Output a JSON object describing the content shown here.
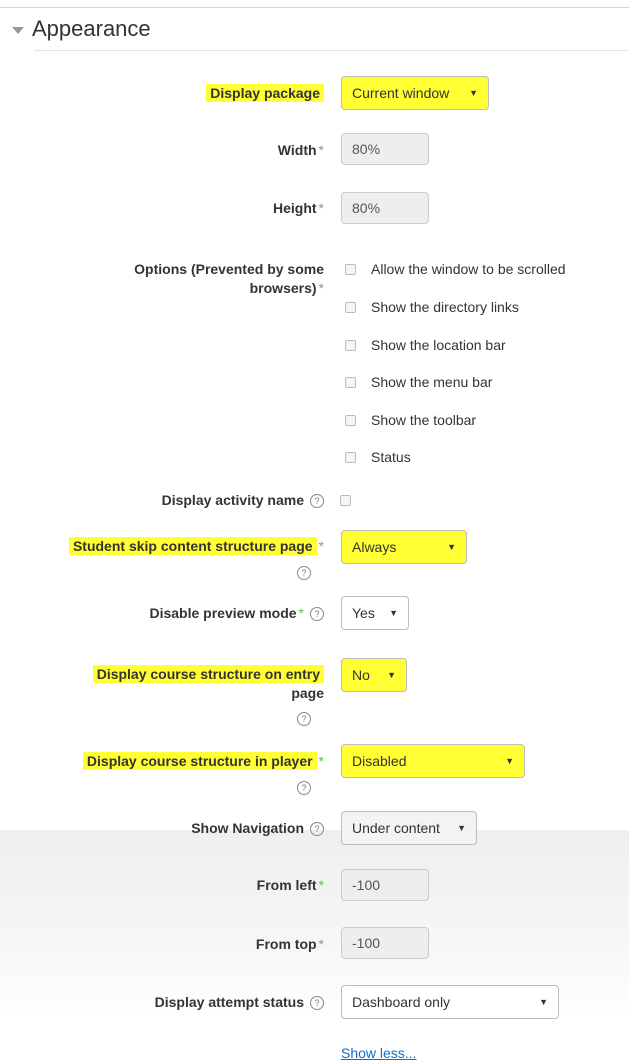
{
  "section": {
    "title": "Appearance"
  },
  "fields": {
    "display_package": {
      "label": "Display package",
      "value": "Current window"
    },
    "width": {
      "label": "Width",
      "value": "80%"
    },
    "height": {
      "label": "Height",
      "value": "80%"
    },
    "options": {
      "label_line1": "Options (Prevented by some",
      "label_line2": "browsers)",
      "items": [
        "Allow the window to be scrolled",
        "Show the directory links",
        "Show the location bar",
        "Show the menu bar",
        "Show the toolbar",
        "Status"
      ]
    },
    "display_activity_name": {
      "label": "Display activity name"
    },
    "student_skip": {
      "label": "Student skip content structure page",
      "value": "Always"
    },
    "disable_preview": {
      "label": "Disable preview mode",
      "value": "Yes"
    },
    "course_structure_entry": {
      "label_line1": "Display course structure on entry",
      "label_line2": "page",
      "value": "No"
    },
    "course_structure_player": {
      "label": "Display course structure in player",
      "value": "Disabled"
    },
    "show_navigation": {
      "label": "Show Navigation",
      "value": "Under content"
    },
    "from_left": {
      "label": "From left",
      "value": "-100"
    },
    "from_top": {
      "label": "From top",
      "value": "-100"
    },
    "attempt_status": {
      "label": "Display attempt status",
      "value": "Dashboard only"
    }
  },
  "symbols": {
    "required": "*",
    "help": "?",
    "arrow": "▼"
  },
  "links": {
    "show_less": "Show less..."
  },
  "colors": {
    "highlight": "#ffff33",
    "required": "#5cb85c",
    "link": "#0f6fc5"
  }
}
